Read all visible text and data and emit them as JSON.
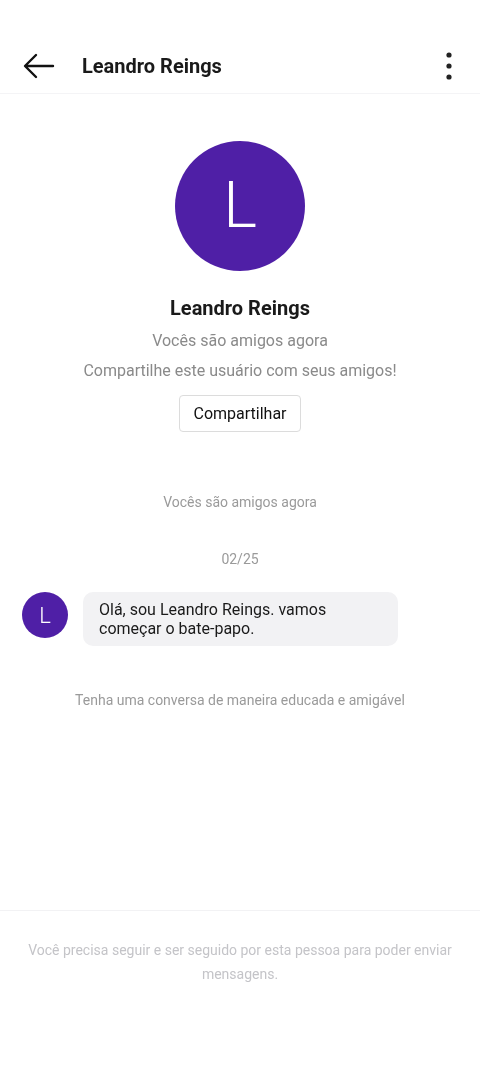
{
  "header": {
    "title": "Leandro Reings"
  },
  "profile": {
    "avatar_letter": "L",
    "name": "Leandro Reings",
    "status": "Vocês são amigos agora",
    "prompt": "Compartilhe este usuário com seus amigos!",
    "share_button": "Compartilhar"
  },
  "chat": [
    {
      "kind": "notice",
      "text": "Vocês são amigos agora"
    },
    {
      "kind": "date",
      "text": "02/25"
    },
    {
      "kind": "message",
      "avatar_letter": "L",
      "text": "Olá, sou Leandro Reings. vamos começar o bate-papo."
    },
    {
      "kind": "notice",
      "text": "Tenha uma conversa de maneira educada e amigável"
    }
  ],
  "footer": {
    "text": "Você precisa seguir e ser seguido por esta pessoa para poder enviar mensagens."
  }
}
